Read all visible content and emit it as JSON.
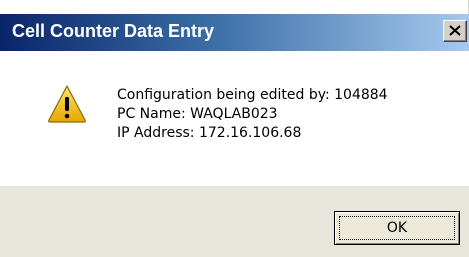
{
  "window": {
    "title": "Cell Counter Data Entry",
    "close_icon": "close-icon"
  },
  "message": {
    "icon": "warning-icon",
    "line1": "Configuration being edited by: 104884",
    "line2": "PC Name: WAQLAB023",
    "line3": "IP Address: 172.16.106.68"
  },
  "buttons": {
    "ok_label": "OK"
  },
  "colors": {
    "titlebar_start": "#0a246a",
    "titlebar_end": "#a6caf0",
    "warning_fill": "#f5c400",
    "footer_bg": "#e8e6dc"
  }
}
